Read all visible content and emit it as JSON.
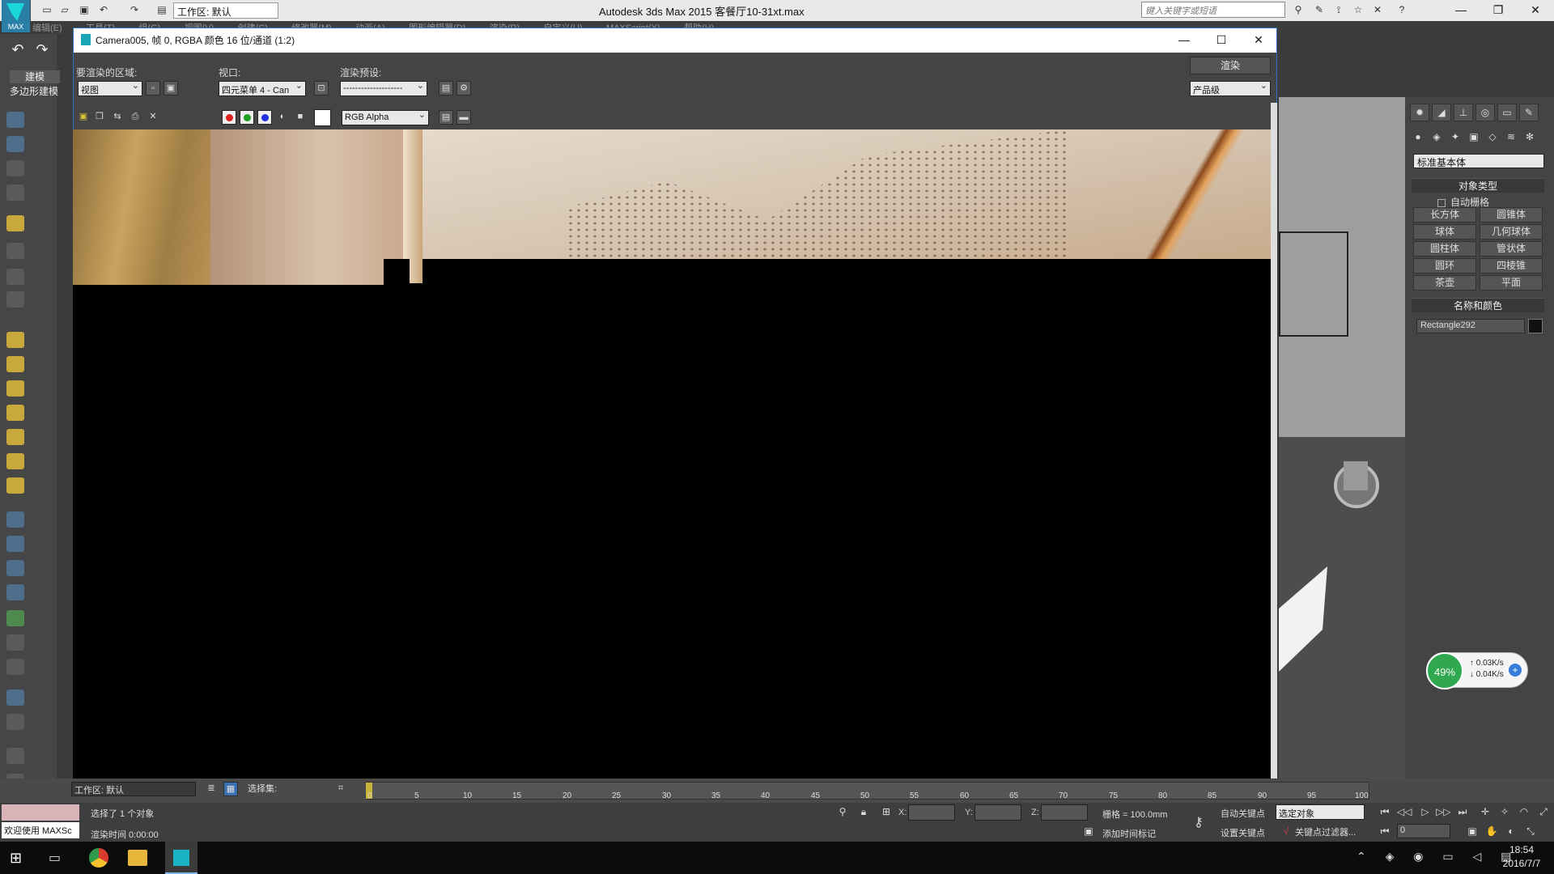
{
  "app": {
    "logo_label": "MAX",
    "title": "Autodesk 3ds Max  2015     客餐厅10-31xt.max",
    "workspace_label": "工作区: 默认",
    "search_placeholder": "键入关键字或短语"
  },
  "menubar": [
    "编辑(E)",
    "工具(T)",
    "组(G)",
    "视图(V)",
    "创建(C)",
    "修改器(M)",
    "动画(A)",
    "图形编辑器(D)",
    "渲染(R)",
    "自定义(U)",
    "MAXScript(X)",
    "帮助(H)"
  ],
  "ribbon": {
    "tab": "建模",
    "subtab": "多边形建模"
  },
  "render_dialog": {
    "title": "Camera005, 帧 0, RGBA 颜色 16 位/通道 (1:2)",
    "area_label": "要渲染的区域:",
    "area_value": "视图",
    "viewport_label": "视口:",
    "viewport_value": "四元菜单 4 - Can",
    "preset_label": "渲染预设:",
    "preset_value": "--------------------",
    "render_button": "渲染",
    "quality_value": "产品级",
    "channel_value": "RGB Alpha"
  },
  "command_panel": {
    "category": "标准基本体",
    "rollout_object_type": "对象类型",
    "autogrid": "自动栅格",
    "objects": [
      "长方体",
      "圆锥体",
      "球体",
      "几何球体",
      "圆柱体",
      "管状体",
      "圆环",
      "四棱锥",
      "茶壶",
      "平面"
    ],
    "rollout_name_color": "名称和颜色",
    "object_name": "Rectangle292",
    "swatch_color": "#111111"
  },
  "timeline": {
    "workspace": "工作区: 默认",
    "selection_set": "选择集:",
    "ticks": [
      "0",
      "5",
      "10",
      "15",
      "20",
      "25",
      "30",
      "35",
      "40",
      "45",
      "50",
      "55",
      "60",
      "65",
      "70",
      "75",
      "80",
      "85",
      "90",
      "95",
      "100"
    ]
  },
  "status": {
    "maxscript_label": "欢迎使用 MAXSc",
    "selected": "选择了 1 个对象",
    "render_time": "渲染时间  0:00:00",
    "x_label": "X:",
    "y_label": "Y:",
    "z_label": "Z:",
    "grid": "栅格 = 100.0mm",
    "add_time_tag": "添加时间标记",
    "auto_key": "自动关键点",
    "selected_object": "选定对象",
    "set_key": "设置关键点",
    "key_filters": "关键点过滤器...",
    "frame": "0"
  },
  "netmeter": {
    "percent": "49%",
    "up": "0.03K/s",
    "down": "0.04K/s"
  },
  "taskbar": {
    "time": "18:54",
    "date": "2016/7/7"
  }
}
